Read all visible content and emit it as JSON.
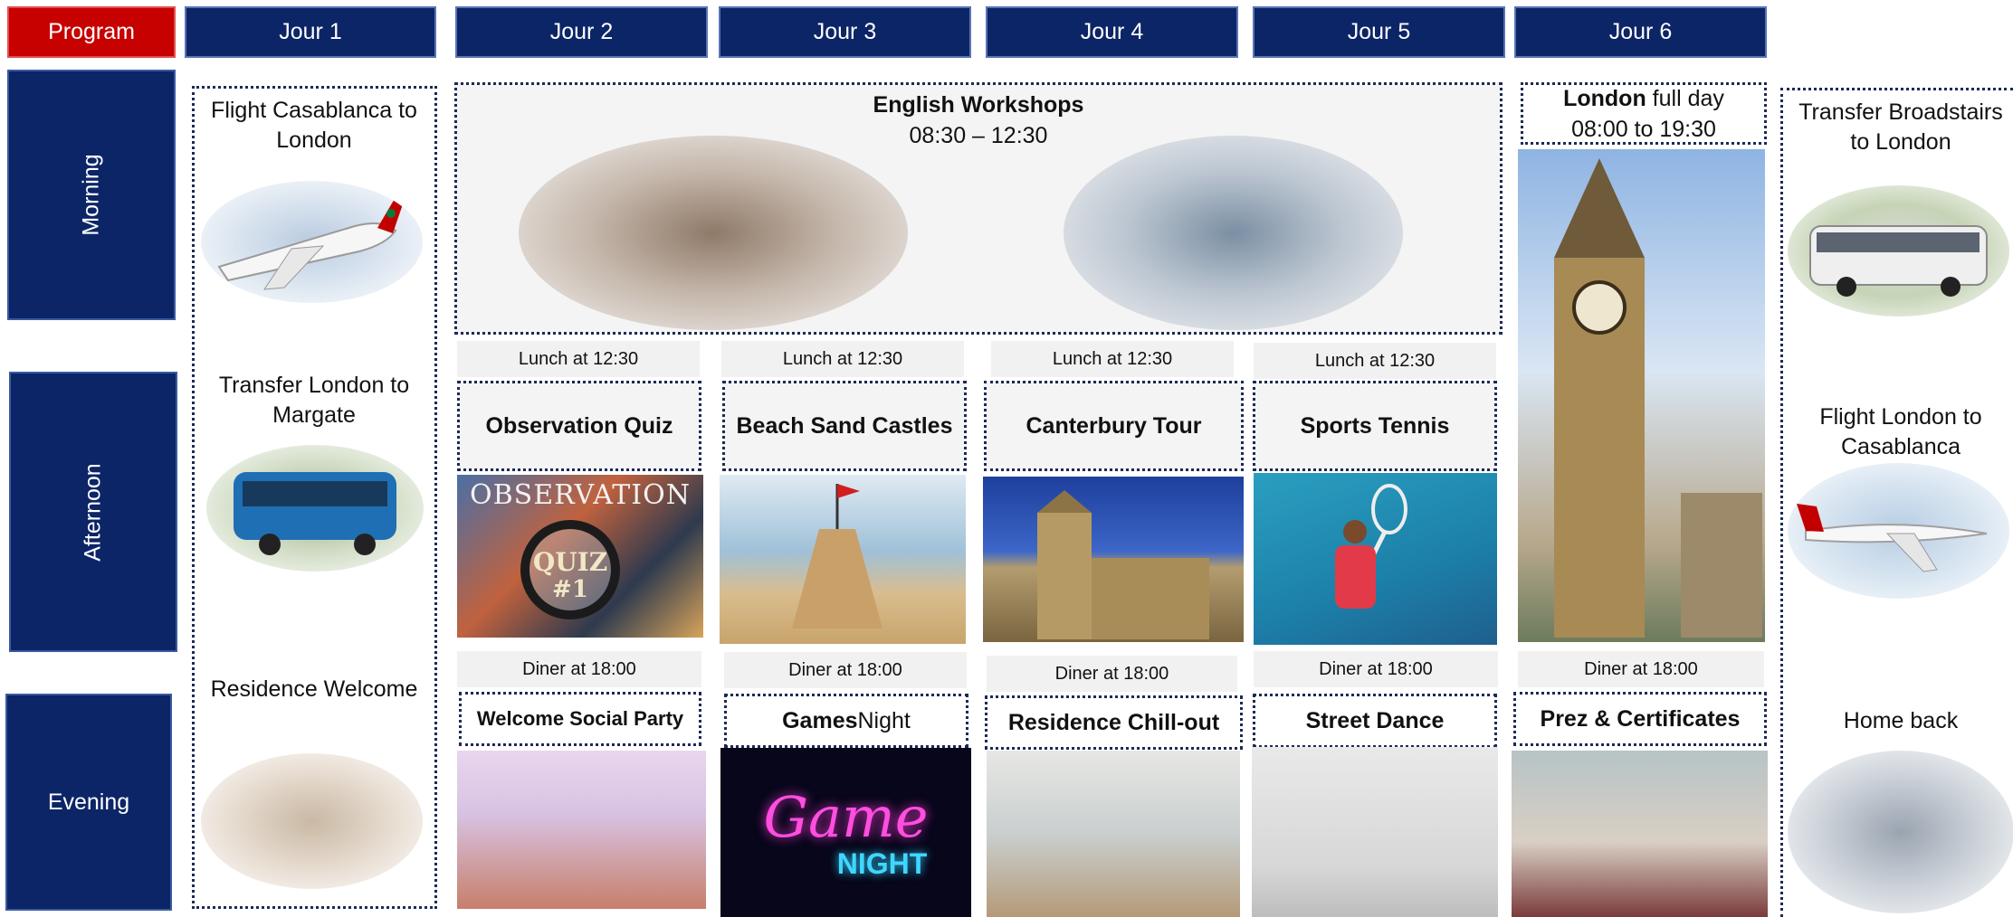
{
  "header": {
    "program": "Program",
    "days": [
      "Jour 1",
      "Jour 2",
      "Jour 3",
      "Jour 4",
      "Jour 5",
      "Jour 6"
    ]
  },
  "periods": {
    "morning": "Morning",
    "afternoon": "Afternoon",
    "evening": "Evening"
  },
  "day1": {
    "morning": "Flight Casablanca to London",
    "afternoon": "Transfer London to Margate",
    "evening": "Residence Welcome"
  },
  "workshops": {
    "title": "English Workshops",
    "time": "08:30 – 12:30"
  },
  "london": {
    "title_bold": "London",
    "title_rest": " full day",
    "time": "08:00 to 19:30"
  },
  "lunch": [
    "Lunch at 12:30",
    "Lunch at 12:30",
    "Lunch at 12:30",
    "Lunch at 12:30"
  ],
  "afternoon_activities": [
    "Observation Quiz",
    "Beach Sand Castles",
    "Canterbury Tour",
    "Sports Tennis"
  ],
  "diner": [
    "Diner at 18:00",
    "Diner at 18:00",
    "Diner at 18:00",
    "Diner at 18:00",
    "Diner at 18:00"
  ],
  "evening_activities": {
    "d2": "Welcome Social Party",
    "d3_bold": "Games",
    "d3_rest": " Night",
    "d4": "Residence Chill-out",
    "d5": "Street Dance",
    "d6": "Prez & Certificates"
  },
  "image_text": {
    "observation": "OBSERVATION",
    "quiz": "QUIZ",
    "quiz_num": "#1",
    "game": "Game",
    "night": "NIGHT"
  },
  "last_day": {
    "morning": "Transfer Broadstairs to London",
    "afternoon": "Flight London to Casablanca",
    "evening": "Home back"
  },
  "colors": {
    "navy": "#0c2566",
    "program_red": "#c70000",
    "dotted_border": "#1c2a55"
  },
  "icons": [
    "airplane-icon",
    "bus-icon",
    "clock-tower-icon",
    "tennis-racket-icon",
    "graduation-icon"
  ]
}
